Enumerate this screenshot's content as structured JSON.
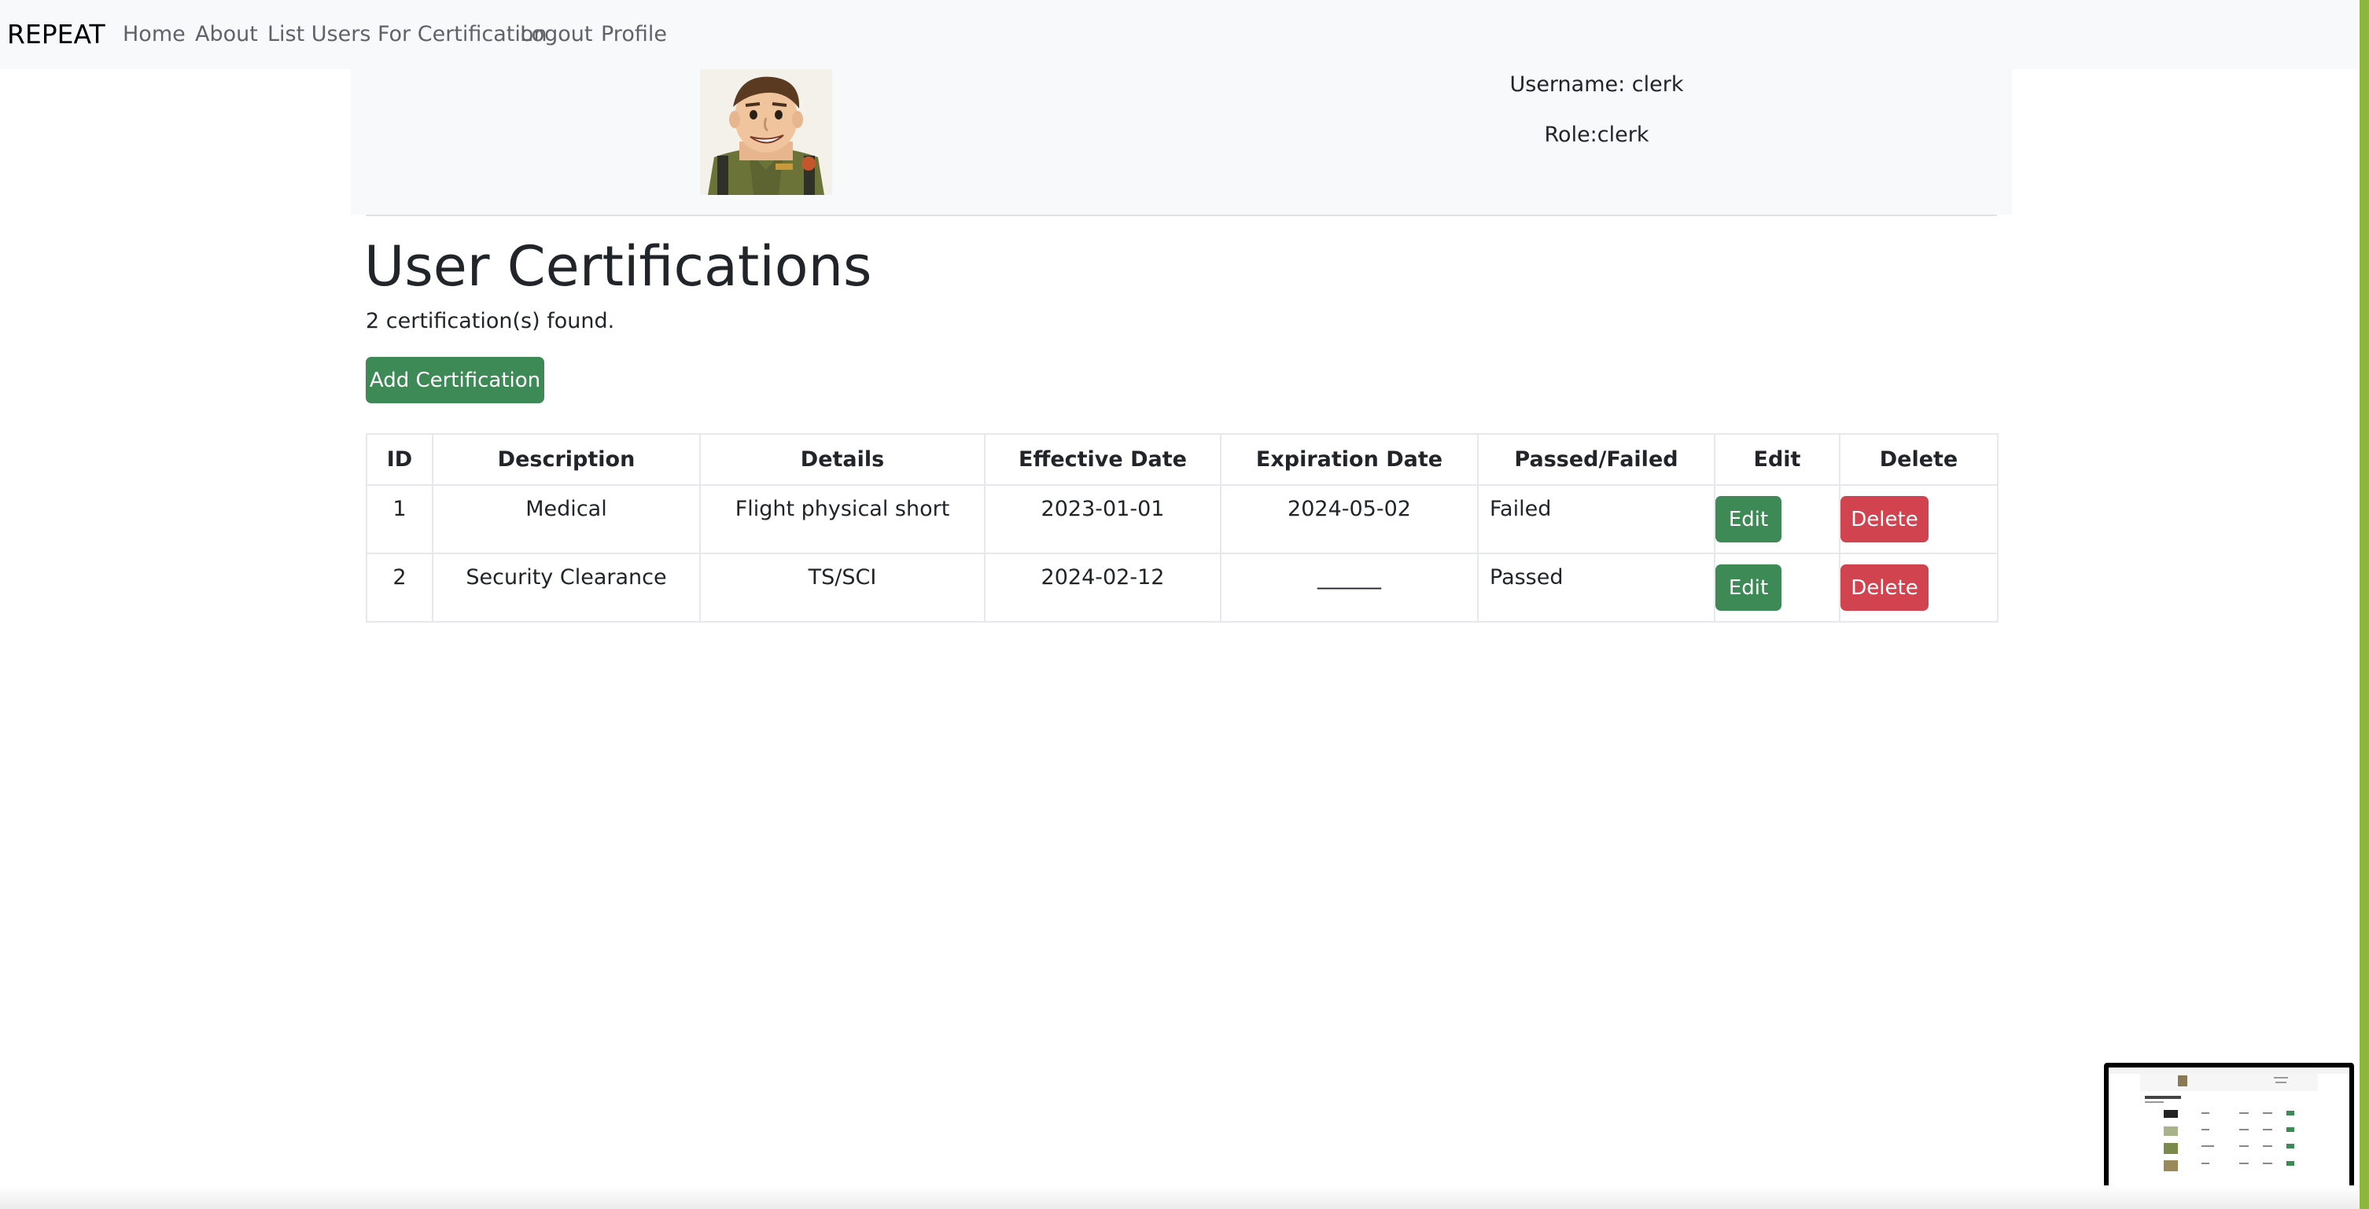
{
  "navbar": {
    "brand": "REPEAT",
    "links": [
      "Home",
      "About",
      "List Users For Certification",
      "Logout",
      "Profile"
    ]
  },
  "profile": {
    "avatar": "cartoon-soldier-avatar",
    "username_text": "Username: clerk",
    "role_text": "Role:clerk"
  },
  "page": {
    "title": "User Certifications",
    "count_text": "2 certification(s) found.",
    "add_button": "Add Certification"
  },
  "table": {
    "headers": [
      "ID",
      "Description",
      "Details",
      "Effective Date",
      "Expiration Date",
      "Passed/Failed",
      "Edit",
      "Delete"
    ],
    "rows": [
      {
        "id": "1",
        "description": "Medical",
        "details": "Flight physical short",
        "effective_date": "2023-01-01",
        "expiration_date": "2024-05-02",
        "status": "Failed",
        "edit": "Edit",
        "delete": "Delete"
      },
      {
        "id": "2",
        "description": "Security Clearance",
        "details": "TS/SCI",
        "effective_date": "2024-02-12",
        "expiration_date": "______",
        "status": "Passed",
        "edit": "Edit",
        "delete": "Delete"
      }
    ]
  },
  "colors": {
    "success": "#3e8a56",
    "danger": "#d1444f",
    "navbar_bg": "#f8f9fa",
    "accent_stripe": "#8cb63c"
  }
}
